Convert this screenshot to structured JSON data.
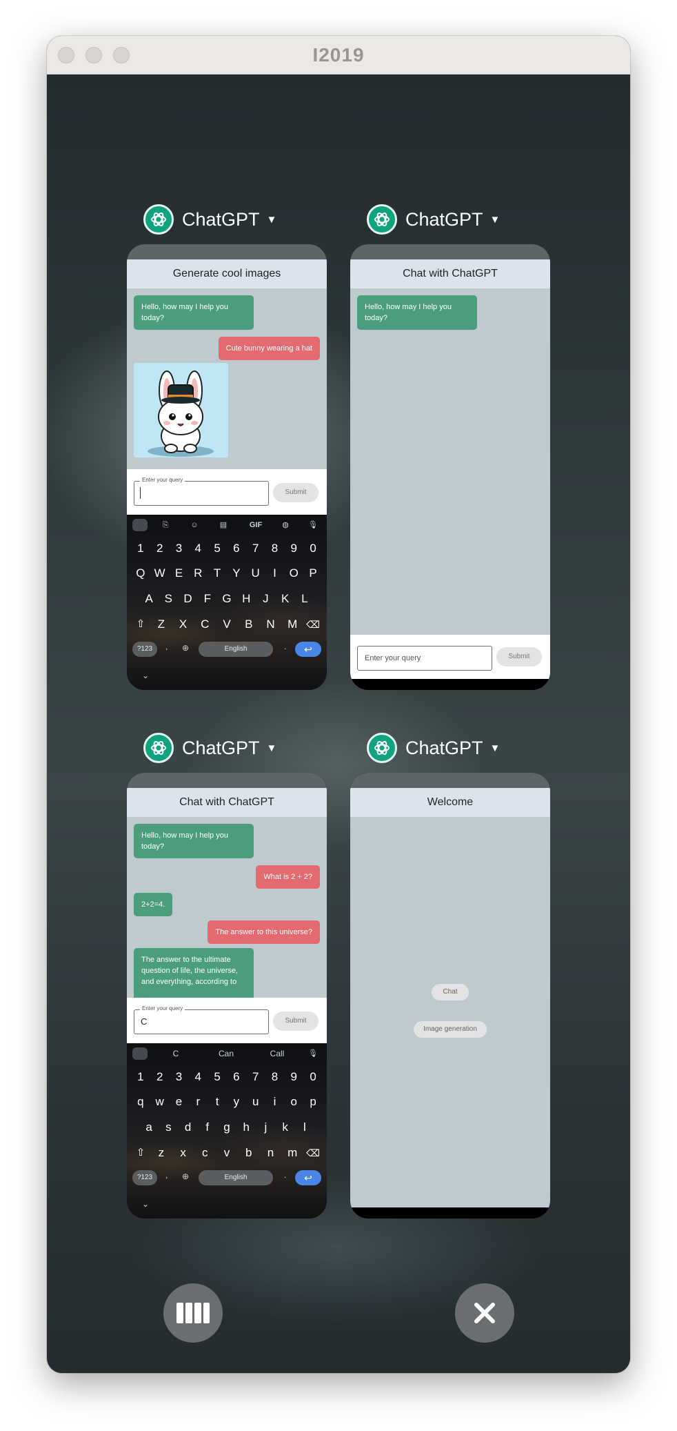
{
  "window": {
    "title": "I2019"
  },
  "cards": [
    {
      "app_name": "ChatGPT",
      "screen_title": "Generate cool images",
      "messages": [
        {
          "role": "bot",
          "text": "Hello, how may I help you today?"
        },
        {
          "role": "user",
          "text": "Cute bunny wearing a hat"
        }
      ],
      "generated_image": "cute-bunny-hat-image",
      "input_label": "Enter your query",
      "input_value": "",
      "submit_label": "Submit",
      "keyboard": {
        "number_row": [
          "1",
          "2",
          "3",
          "4",
          "5",
          "6",
          "7",
          "8",
          "9",
          "0"
        ],
        "row1": [
          "Q",
          "W",
          "E",
          "R",
          "T",
          "Y",
          "U",
          "I",
          "O",
          "P"
        ],
        "row2": [
          "A",
          "S",
          "D",
          "F",
          "G",
          "H",
          "J",
          "K",
          "L"
        ],
        "row3": [
          "Z",
          "X",
          "C",
          "V",
          "B",
          "N",
          "M"
        ],
        "symbols_label": "?123",
        "space_label": "English",
        "gif_label": "GIF"
      }
    },
    {
      "app_name": "ChatGPT",
      "screen_title": "Chat with ChatGPT",
      "messages": [
        {
          "role": "bot",
          "text": "Hello, how may I help you today?"
        }
      ],
      "input_placeholder": "Enter your query",
      "submit_label": "Submit"
    },
    {
      "app_name": "ChatGPT",
      "screen_title": "Chat with ChatGPT",
      "messages": [
        {
          "role": "bot",
          "text": "Hello, how may I help you today?"
        },
        {
          "role": "user",
          "text": "What is 2 + 2?"
        },
        {
          "role": "bot",
          "text": "2+2=4."
        },
        {
          "role": "user",
          "text": "The answer to this universe?"
        },
        {
          "role": "bot",
          "text": "The answer to the ultimate question of life, the universe, and everything, according to"
        }
      ],
      "input_label": "Enter your query",
      "input_value": "C",
      "submit_label": "Submit",
      "keyboard": {
        "suggestions": [
          "C",
          "Can",
          "Call"
        ],
        "number_row": [
          "1",
          "2",
          "3",
          "4",
          "5",
          "6",
          "7",
          "8",
          "9",
          "0"
        ],
        "row1": [
          "q",
          "w",
          "e",
          "r",
          "t",
          "y",
          "u",
          "i",
          "o",
          "p"
        ],
        "row2": [
          "a",
          "s",
          "d",
          "f",
          "g",
          "h",
          "j",
          "k",
          "l"
        ],
        "row3": [
          "z",
          "x",
          "c",
          "v",
          "b",
          "n",
          "m"
        ],
        "symbols_label": "?123",
        "space_label": "English"
      }
    },
    {
      "app_name": "ChatGPT",
      "screen_title": "Welcome",
      "buttons": [
        "Chat",
        "Image generation"
      ]
    }
  ],
  "controls": {
    "tile_icon": "columns-icon",
    "close_icon": "close-icon"
  }
}
